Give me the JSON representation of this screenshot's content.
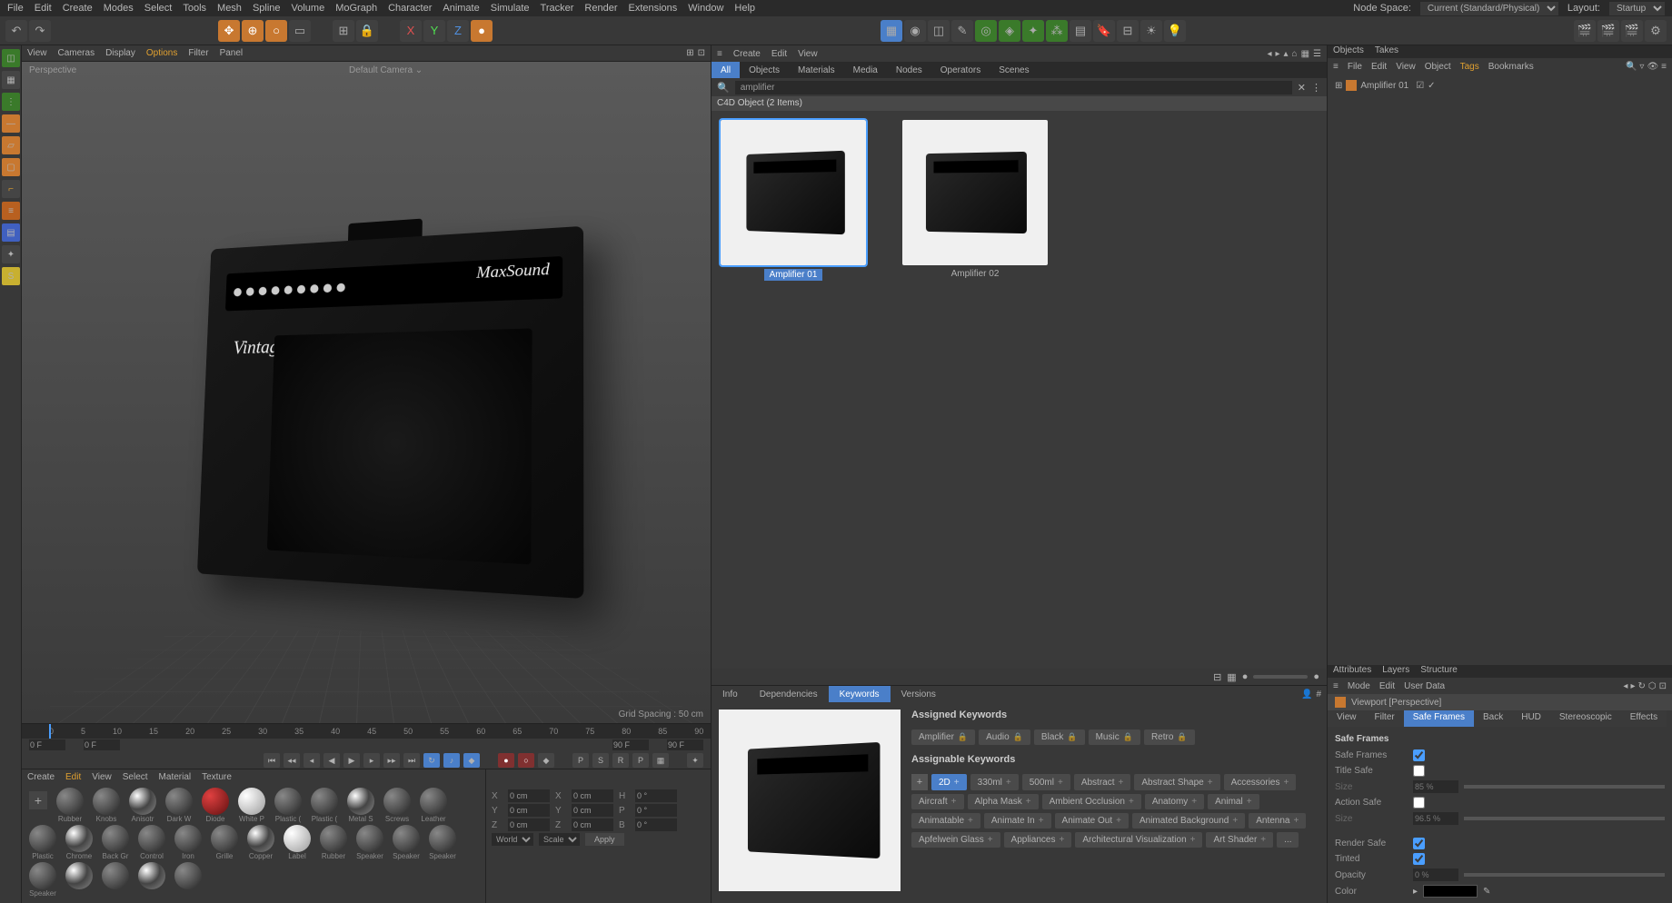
{
  "menubar": {
    "items": [
      "File",
      "Edit",
      "Create",
      "Modes",
      "Select",
      "Tools",
      "Mesh",
      "Spline",
      "Volume",
      "MoGraph",
      "Character",
      "Animate",
      "Simulate",
      "Tracker",
      "Render",
      "Extensions",
      "Window",
      "Help"
    ],
    "node_space_label": "Node Space:",
    "node_space_value": "Current (Standard/Physical)",
    "layout_label": "Layout:",
    "layout_value": "Startup"
  },
  "viewport": {
    "menu": [
      "View",
      "Cameras",
      "Display",
      "Options",
      "Filter",
      "Panel"
    ],
    "label": "Perspective",
    "camera": "Default Camera",
    "grid_spacing": "Grid Spacing : 50 cm",
    "brand": "MaxSound",
    "vintage": "Vintage"
  },
  "timeline": {
    "ticks": [
      "0",
      "5",
      "10",
      "15",
      "20",
      "25",
      "30",
      "35",
      "40",
      "45",
      "50",
      "55",
      "60",
      "65",
      "70",
      "75",
      "80",
      "85",
      "90"
    ],
    "start": "0 F",
    "end": "90 F",
    "range_start": "0 F",
    "range_end": "90 F"
  },
  "materials": {
    "menu": [
      "Create",
      "Edit",
      "View",
      "Select",
      "Material",
      "Texture"
    ],
    "items": [
      "Rubber",
      "Knobs",
      "Anisotr",
      "Dark W",
      "Diode",
      "White P",
      "Plastic (",
      "Plastic (",
      "Metal S",
      "Screws",
      "Leather",
      "Plastic",
      "Chrome",
      "Back Gr",
      "Control",
      "Iron",
      "Grille",
      "Copper",
      "Label",
      "Rubber",
      "Speaker",
      "Speaker",
      "Speaker",
      "Speaker"
    ]
  },
  "coords": {
    "labels": [
      "X",
      "Y",
      "Z"
    ],
    "pos": [
      "0 cm",
      "0 cm",
      "0 cm"
    ],
    "size": [
      "0 cm",
      "0 cm",
      "0 cm"
    ],
    "rot_labels": [
      "H",
      "P",
      "B"
    ],
    "rot": [
      "0 °",
      "0 °",
      "0 °"
    ],
    "world": "World",
    "scale": "Scale",
    "apply": "Apply"
  },
  "asset_browser": {
    "menu": [
      "Create",
      "Edit",
      "View"
    ],
    "tabs": [
      "All",
      "Objects",
      "Materials",
      "Media",
      "Nodes",
      "Operators",
      "Scenes"
    ],
    "active_tab": "All",
    "search": "amplifier",
    "header": "C4D Object (2 Items)",
    "items": [
      {
        "name": "Amplifier 01",
        "selected": true
      },
      {
        "name": "Amplifier 02",
        "selected": false
      }
    ]
  },
  "info_panel": {
    "tabs": [
      "Info",
      "Dependencies",
      "Keywords",
      "Versions"
    ],
    "active_tab": "Keywords",
    "assigned_title": "Assigned Keywords",
    "assigned": [
      "Amplifier",
      "Audio",
      "Black",
      "Music",
      "Retro"
    ],
    "assignable_title": "Assignable Keywords",
    "assignable": [
      "2D",
      "330ml",
      "500ml",
      "Abstract",
      "Abstract Shape",
      "Accessories",
      "Aircraft",
      "Alpha Mask",
      "Ambient Occlusion",
      "Anatomy",
      "Animal",
      "Animatable",
      "Animate In",
      "Animate Out",
      "Animated Background",
      "Antenna",
      "Apfelwein Glass",
      "Appliances",
      "Architectural Visualization",
      "Art Shader",
      "..."
    ]
  },
  "objects_panel": {
    "tabs": [
      "Objects",
      "Takes"
    ],
    "menu": [
      "File",
      "Edit",
      "View",
      "Object",
      "Tags",
      "Bookmarks"
    ],
    "tree_item": "Amplifier 01"
  },
  "attributes": {
    "tabs": [
      "Attributes",
      "Layers",
      "Structure"
    ],
    "menu": [
      "Mode",
      "Edit",
      "User Data"
    ],
    "title": "Viewport [Perspective]",
    "sub_tabs": [
      "View",
      "Filter",
      "Safe Frames",
      "Back",
      "HUD",
      "Stereoscopic",
      "Effects"
    ],
    "active_sub_tab": "Safe Frames",
    "section": "Safe Frames",
    "fields": {
      "safe_frames_label": "Safe Frames",
      "safe_frames_checked": true,
      "title_safe_label": "Title Safe",
      "title_safe_checked": false,
      "size1_label": "Size",
      "size1_value": "85 %",
      "action_safe_label": "Action Safe",
      "action_safe_checked": false,
      "size2_label": "Size",
      "size2_value": "96.5 %",
      "render_safe_label": "Render Safe",
      "render_safe_checked": true,
      "tinted_label": "Tinted",
      "tinted_checked": true,
      "opacity_label": "Opacity",
      "opacity_value": "0 %",
      "color_label": "Color"
    }
  }
}
